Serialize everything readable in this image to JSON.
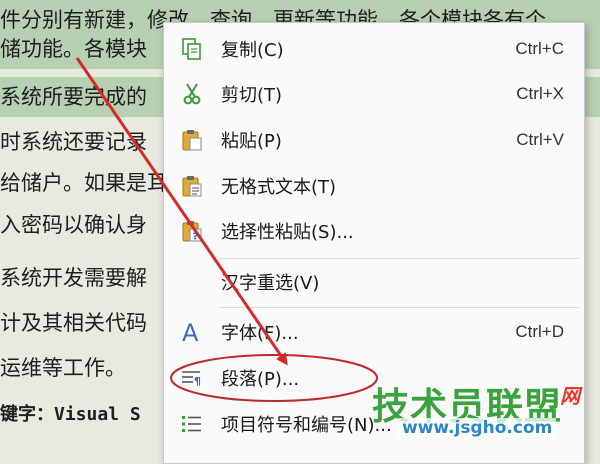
{
  "document": {
    "lines": [
      "件分别有新建，修改，查询，更新等功能。各个模块各有个",
      "储功能。各模块",
      "系统所要完成的",
      "时系统还要记录",
      "给储户。如果是耳",
      "入密码以确认身",
      "系统开发需要解",
      "计及其相关代码",
      "运维等工作。",
      "键字：Visual S"
    ]
  },
  "context_menu": {
    "items": [
      {
        "label": "复制(C)",
        "shortcut": "Ctrl+C",
        "icon": "copy-icon"
      },
      {
        "label": "剪切(T)",
        "shortcut": "Ctrl+X",
        "icon": "scissors-icon"
      },
      {
        "label": "粘贴(P)",
        "shortcut": "Ctrl+V",
        "icon": "paste-icon"
      },
      {
        "label": "无格式文本(T)",
        "shortcut": "",
        "icon": "paste-text-icon"
      },
      {
        "label": "选择性粘贴(S)...",
        "shortcut": "",
        "icon": "paste-special-icon"
      },
      {
        "label": "汉字重选(V)",
        "shortcut": "",
        "icon": ""
      },
      {
        "label": "字体(F)...",
        "shortcut": "Ctrl+D",
        "icon": "font-icon"
      },
      {
        "label": "段落(P)...",
        "shortcut": "",
        "icon": "paragraph-icon"
      },
      {
        "label": "项目符号和编号(N)...",
        "shortcut": "",
        "icon": "bullet-list-icon"
      }
    ]
  },
  "watermark": {
    "main": "技术员联盟",
    "suffix": "网",
    "url": "www.jsgho.com"
  },
  "colors": {
    "arrow": "#d42a2a",
    "highlight": "#b8d0b2",
    "watermark_green": "#3ba33e",
    "watermark_blue": "#2e86c8"
  }
}
